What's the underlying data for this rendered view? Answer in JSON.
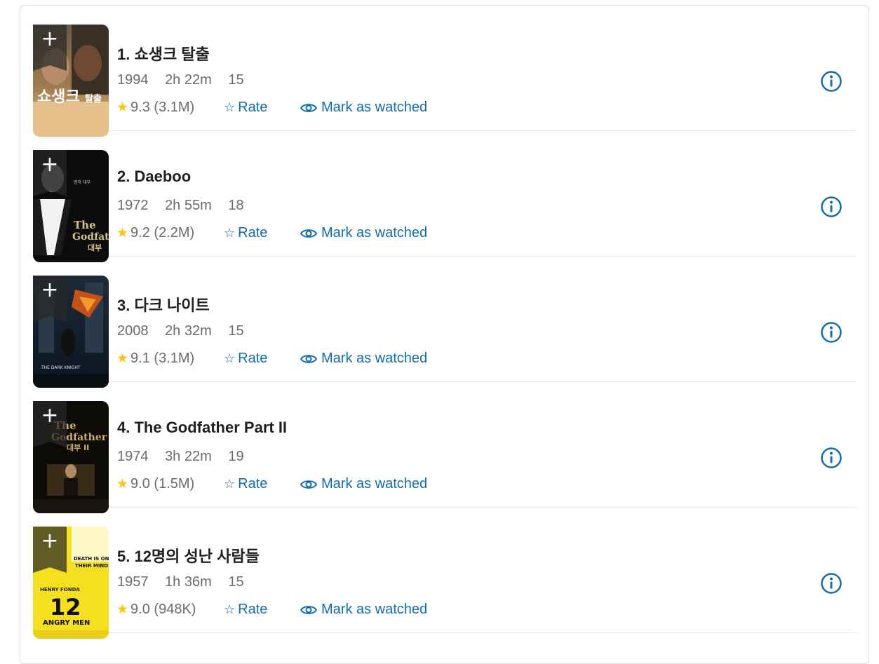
{
  "colors": {
    "accent": "#136cb2",
    "star": "#f5c518",
    "meta": "#6b6b6b",
    "title": "#1f1f1f"
  },
  "icons": {
    "add": "plus-icon",
    "star": "star-filled-icon",
    "rate": "star-outline-icon",
    "watched": "eye-icon",
    "info": "info-circle-icon"
  },
  "movies": [
    {
      "title": "1. 쇼생크 탈출",
      "year": "1994",
      "runtime": "2h 22m",
      "certificate": "15",
      "rating": "9.3",
      "votes": "(3.1M)",
      "rate_label": "Rate",
      "watched_label": "Mark as watched",
      "add_label": "+"
    },
    {
      "title": "2. Daeboo",
      "year": "1972",
      "runtime": "2h 55m",
      "certificate": "18",
      "rating": "9.2",
      "votes": "(2.2M)",
      "rate_label": "Rate",
      "watched_label": "Mark as watched",
      "add_label": "+"
    },
    {
      "title": "3. 다크 나이트",
      "year": "2008",
      "runtime": "2h 32m",
      "certificate": "15",
      "rating": "9.1",
      "votes": "(3.1M)",
      "rate_label": "Rate",
      "watched_label": "Mark as watched",
      "add_label": "+"
    },
    {
      "title": "4. The Godfather Part II",
      "year": "1974",
      "runtime": "3h 22m",
      "certificate": "19",
      "rating": "9.0",
      "votes": "(1.5M)",
      "rate_label": "Rate",
      "watched_label": "Mark as watched",
      "add_label": "+"
    },
    {
      "title": "5. 12명의 성난 사람들",
      "year": "1957",
      "runtime": "1h 36m",
      "certificate": "15",
      "rating": "9.0",
      "votes": "(948K)",
      "rate_label": "Rate",
      "watched_label": "Mark as watched",
      "add_label": "+"
    }
  ]
}
